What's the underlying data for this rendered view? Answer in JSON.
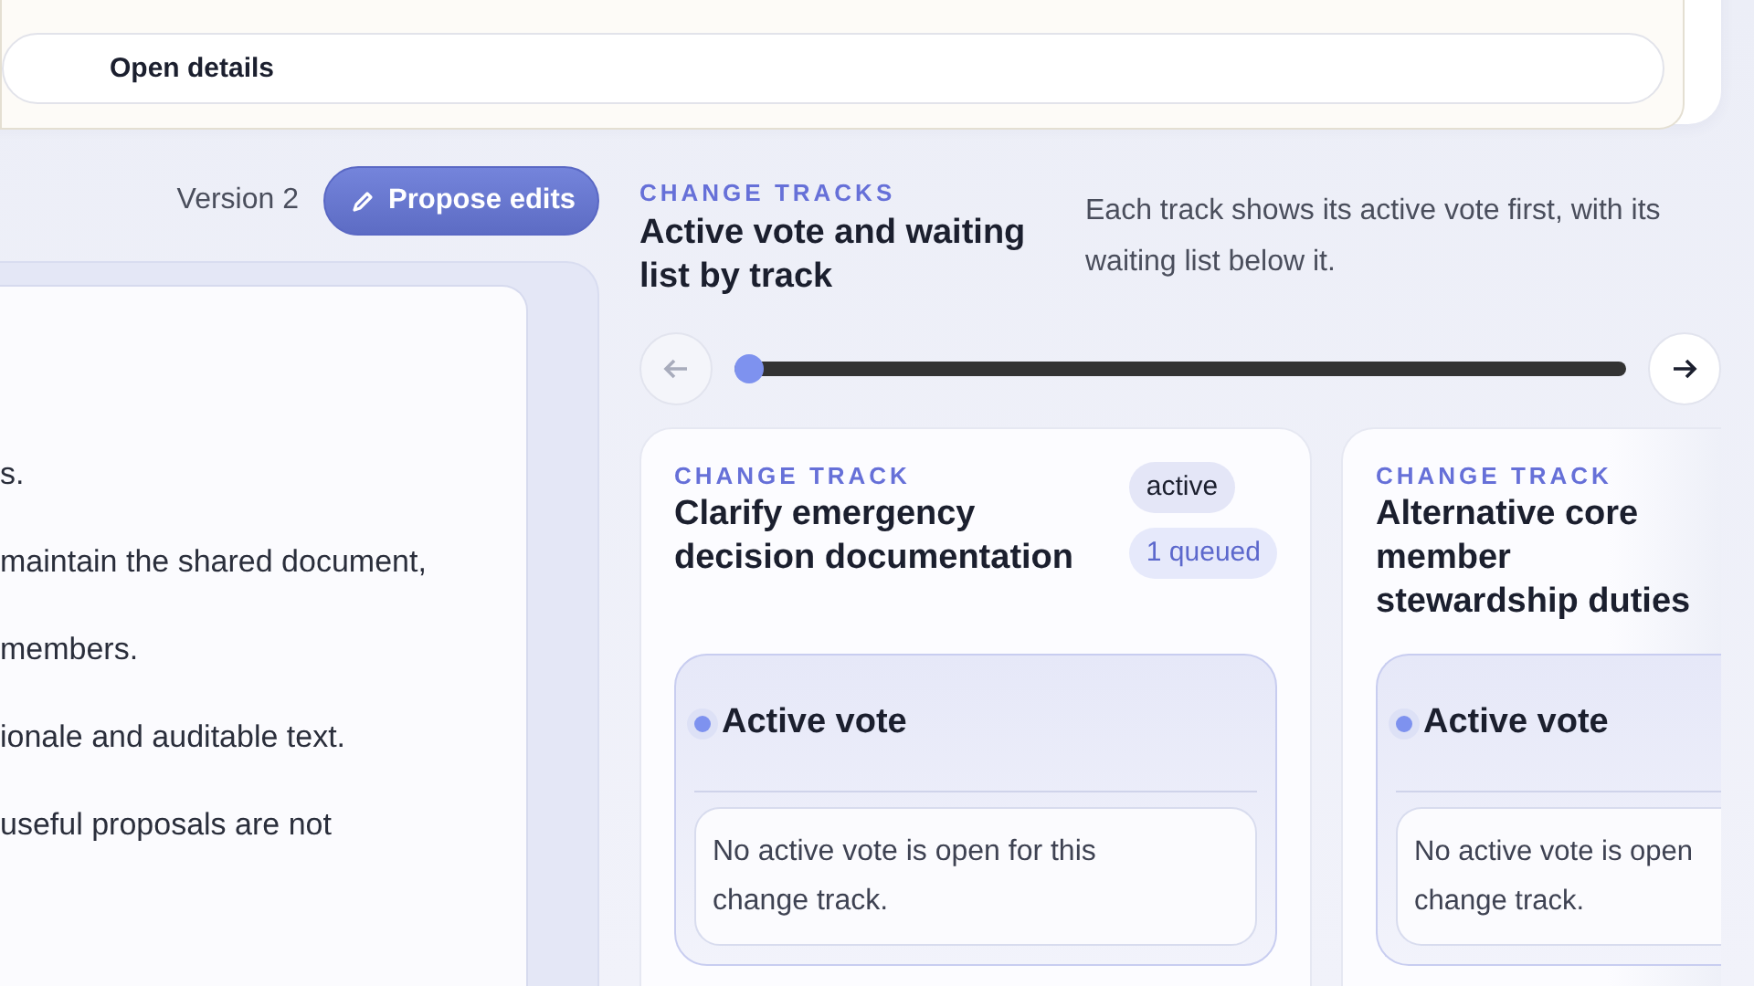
{
  "top_card": {
    "button": "Open details"
  },
  "document": {
    "version": "Version 2",
    "propose_button": "Propose edits",
    "lines": [
      "s.",
      "maintain the shared document,",
      "members.",
      "ionale and auditable text.",
      "useful proposals are not"
    ]
  },
  "change_tracks": {
    "eyebrow": "CHANGE TRACKS",
    "title": "Active vote and waiting list by track",
    "description": "Each track shows its active vote first, with its waiting list below it.",
    "prev_disabled": true,
    "next_disabled": false,
    "scroll": {
      "level": 0
    },
    "tracks": [
      {
        "eyebrow": "CHANGE TRACK",
        "title": "Clarify emergency decision documentation",
        "badges": [
          {
            "kind": "status",
            "text": "active"
          },
          {
            "kind": "queue",
            "text": "1 queued"
          }
        ],
        "vote_heading": "Active vote",
        "vote_lines": [
          "No active vote is open for this",
          "change track."
        ]
      },
      {
        "eyebrow": "CHANGE TRACK",
        "title": "Alternative core member stewardship duties",
        "vote_heading": "Active vote",
        "vote_lines": [
          "No active vote is open",
          "change track."
        ]
      }
    ]
  }
}
